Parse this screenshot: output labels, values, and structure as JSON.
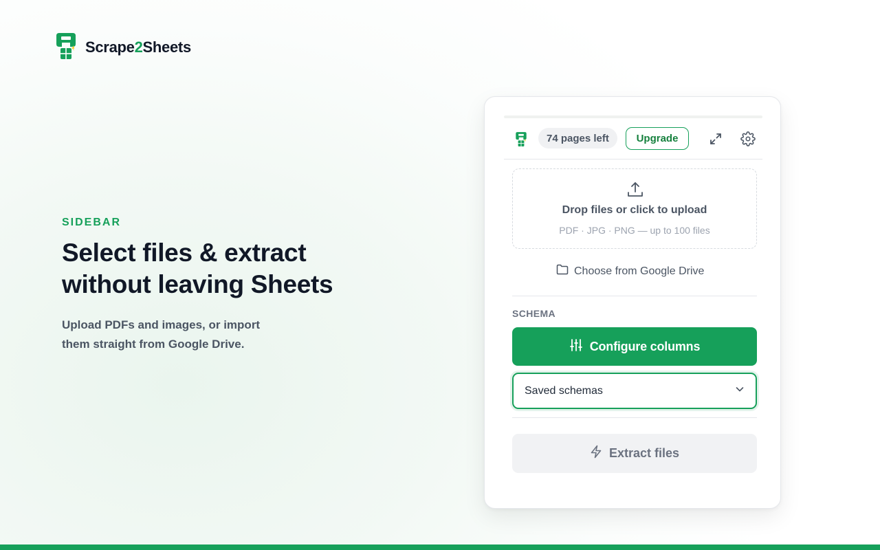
{
  "brand": {
    "name_part1": "Scrape",
    "name_part2": "2",
    "name_part3": "Sheets",
    "logo_icon": "scrape2sheets-logo-icon"
  },
  "hero": {
    "eyebrow": "SIDEBAR",
    "headline_line1": "Select files & extract",
    "headline_line2": "without leaving Sheets",
    "subline_line1": "Upload PDFs and images, or import",
    "subline_line2": "them straight from Google Drive."
  },
  "sidebar": {
    "header": {
      "pages_left": "74 pages left",
      "upgrade_label": "Upgrade",
      "expand_icon": "expand-icon",
      "settings_icon": "gear-icon"
    },
    "upload": {
      "icon": "upload-icon",
      "title": "Drop files or click to upload",
      "subtitle": "PDF · JPG · PNG — up to 100 files"
    },
    "google_drive": {
      "icon": "folder-icon",
      "label": "Choose from Google Drive"
    },
    "schema": {
      "section_label": "SCHEMA",
      "configure_label": "Configure columns",
      "configure_icon": "sliders-icon",
      "saved_schemas_value": "Saved schemas",
      "dropdown_icon": "chevron-down-icon"
    },
    "extract": {
      "label": "Extract files",
      "icon": "lightning-icon"
    }
  },
  "colors": {
    "accent": "#16a05a",
    "accent_dark": "#15803d",
    "text_primary": "#111827",
    "text_secondary": "#4b5563",
    "muted_bg": "#f1f2f4"
  }
}
